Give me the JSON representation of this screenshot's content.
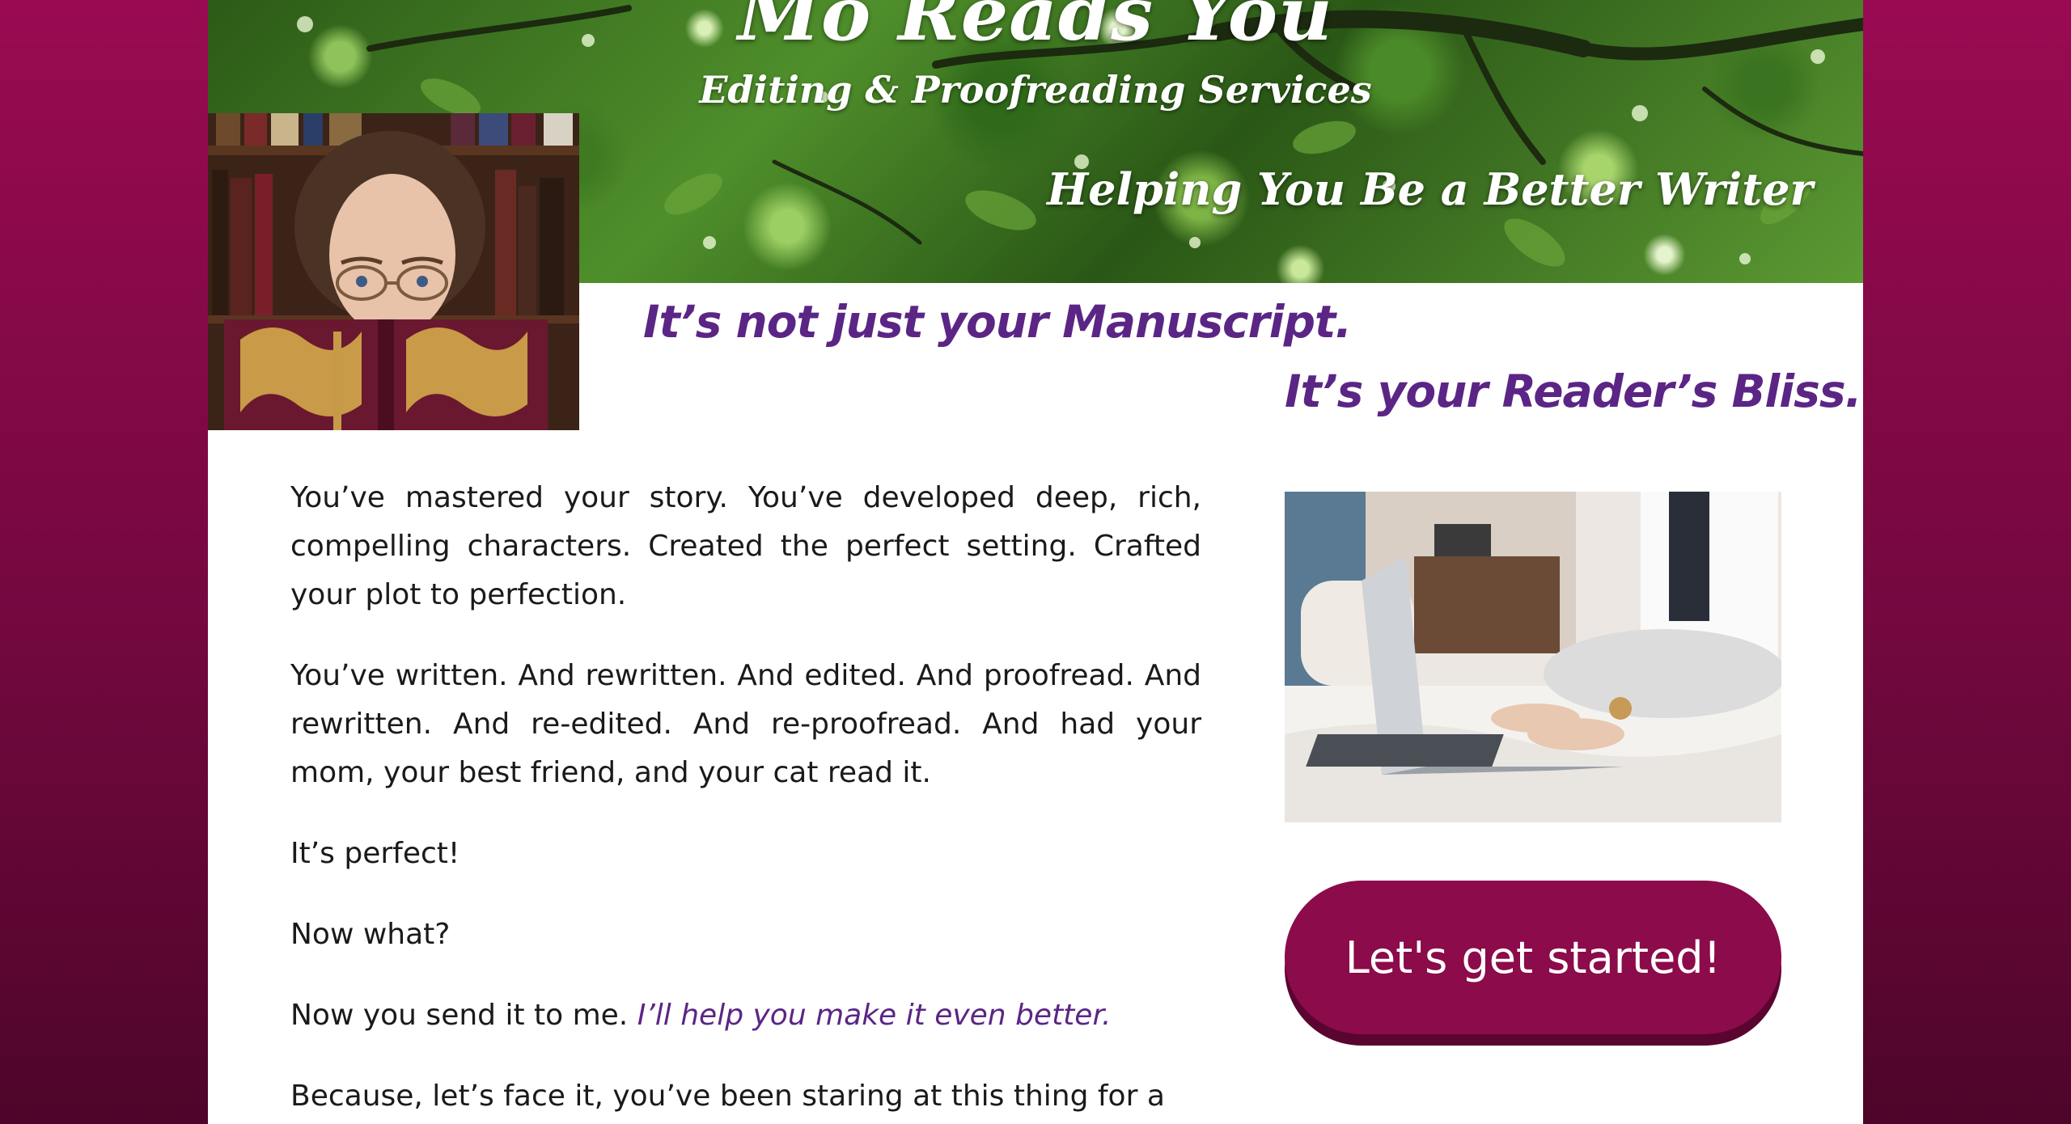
{
  "header": {
    "site_title": "Mo Reads You",
    "subtitle": "Editing & Proofreading Services",
    "tagline": "Helping You Be a Better Writer"
  },
  "headlines": {
    "first": "It’s not just your Manuscript.",
    "second": "It’s your Reader’s Bliss."
  },
  "body": {
    "paragraphs": [
      "You’ve mastered your story. You’ve developed deep, rich, compelling characters. Created the perfect setting. Crafted your plot to perfection.",
      "You’ve written. And rewritten. And edited. And proofread. And rewritten. And re-edited. And re-proofread. And had your mom, your best friend, and your cat read it.",
      "It’s perfect!",
      "Now what?"
    ],
    "send_text": "Now you send it to me.",
    "send_accent": "I’ll help you make it even better.",
    "last_paragraph": "Because, let’s face it, you’ve been staring at this thing for a"
  },
  "cta": {
    "label": "Let's get started!"
  },
  "colors": {
    "accent": "#5b2585",
    "brand": "#8c0b4a",
    "background": "#7a0843"
  }
}
